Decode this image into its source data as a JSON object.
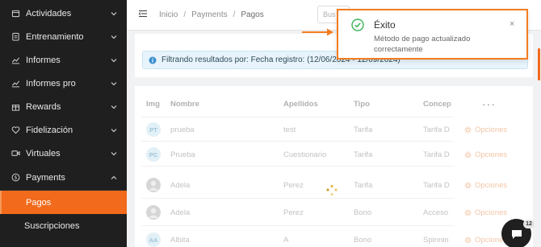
{
  "sidebar": {
    "items": [
      {
        "label": "Actividades",
        "icon": "calendar-icon"
      },
      {
        "label": "Entrenamiento",
        "icon": "clipboard-icon"
      },
      {
        "label": "Informes",
        "icon": "chart-line-icon"
      },
      {
        "label": "Informes pro",
        "icon": "chart-line-icon"
      },
      {
        "label": "Rewards",
        "icon": "gift-icon"
      },
      {
        "label": "Fidelización",
        "icon": "heart-icon"
      },
      {
        "label": "Virtuales",
        "icon": "video-icon"
      },
      {
        "label": "Payments",
        "icon": "dollar-circle-icon"
      }
    ],
    "sub_items": [
      {
        "label": "Pagos",
        "active": true
      },
      {
        "label": "Suscripciones",
        "active": false
      }
    ]
  },
  "topbar": {
    "breadcrumb": [
      "Inicio",
      "Payments",
      "Pagos"
    ],
    "search_placeholder": "Bus"
  },
  "filter_alert": {
    "text": "Filtrando resultados por: Fecha registro: (12/06/2024 - 12/09/2024)"
  },
  "table": {
    "headers": [
      "Img",
      "Nombre",
      "Apellidos",
      "Tipo",
      "Concep"
    ],
    "rows": [
      {
        "avatar": "PT",
        "nombre": "prueba",
        "apellidos": "test",
        "tipo": "Tarifa",
        "concepto": "Tarifa D",
        "opciones": "Opciones"
      },
      {
        "avatar": "PC",
        "nombre": "Prueba",
        "apellidos": "Cuestionario",
        "tipo": "Tarifa",
        "concepto": "Tarifa D",
        "opciones": "Opciones"
      },
      {
        "avatar": "",
        "nombre": "Adela",
        "apellidos": "Perez",
        "tipo": "Tarifa",
        "concepto": "Tarifa D",
        "opciones": "Opciones"
      },
      {
        "avatar": "",
        "nombre": "Adela",
        "apellidos": "Perez",
        "tipo": "Bono",
        "concepto": "Acceso",
        "opciones": "Opciones"
      },
      {
        "avatar": "AA",
        "nombre": "Albita",
        "apellidos": "A",
        "tipo": "Bono",
        "concepto": "Spinnin",
        "opciones": "Opciones"
      }
    ],
    "more_label": "···"
  },
  "toast": {
    "title": "Éxito",
    "message": "Método de pago actualizado correctamente",
    "close": "×"
  },
  "chat": {
    "badge": "12"
  },
  "colors": {
    "accent": "#f26a1b",
    "sidebar_bg": "#1f1f1f",
    "success": "#3cb35a"
  }
}
